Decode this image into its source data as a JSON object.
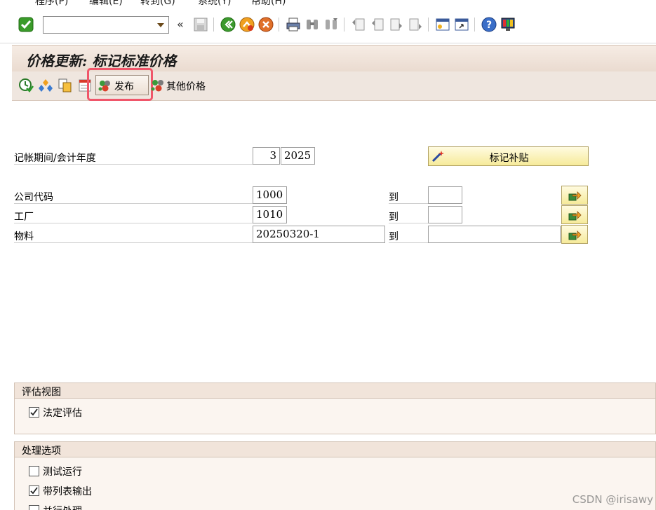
{
  "menu": {
    "items": [
      "程序(P)",
      "编辑(E)",
      "转到(G)",
      "系统(Y)",
      "帮助(H)"
    ]
  },
  "toolbar": {
    "command_field_value": "",
    "collapse_label": "«"
  },
  "title": "价格更新: 标记标准价格",
  "app_toolbar": {
    "publish_label": "发布",
    "other_prices_label": "其他价格"
  },
  "form": {
    "posting_period_label": "记帐期间/会计年度",
    "period_value": "3",
    "year_value": "2025",
    "mark_button_label": "标记补贴",
    "company_code_label": "公司代码",
    "company_code_value": "1000",
    "company_code_to_label": "到",
    "company_code_to_value": "",
    "plant_label": "工厂",
    "plant_value": "1010",
    "plant_to_label": "到",
    "plant_to_value": "",
    "material_label": "物料",
    "material_value": "20250320-1",
    "material_to_label": "到",
    "material_to_value": ""
  },
  "valuation_view": {
    "header": "评估视图",
    "legal_valuation_label": "法定评估",
    "legal_valuation_checked": true
  },
  "processing_options": {
    "header": "处理选项",
    "test_run_label": "测试运行",
    "test_run_checked": false,
    "list_output_label": "带列表输出",
    "list_output_checked": true,
    "parallel_label": "并行处理",
    "parallel_checked": false
  },
  "watermark": "CSDN @irisawy",
  "colors": {
    "title_bg": "#eadbd0",
    "highlight": "#f0566a",
    "button_yellow": "#f6ea9a"
  },
  "icons": {
    "enter": "check-icon",
    "save": "save-icon",
    "back": "back-icon",
    "exit": "exit-icon",
    "cancel": "cancel-icon",
    "print": "print-icon",
    "find": "find-icon",
    "find_next": "find-next-icon",
    "first_page": "first-page-icon",
    "prev_page": "prev-page-icon",
    "next_page": "next-page-icon",
    "last_page": "last-page-icon",
    "new_session": "new-session-icon",
    "shortcut": "shortcut-icon",
    "help": "help-icon",
    "layout": "layout-icon"
  }
}
